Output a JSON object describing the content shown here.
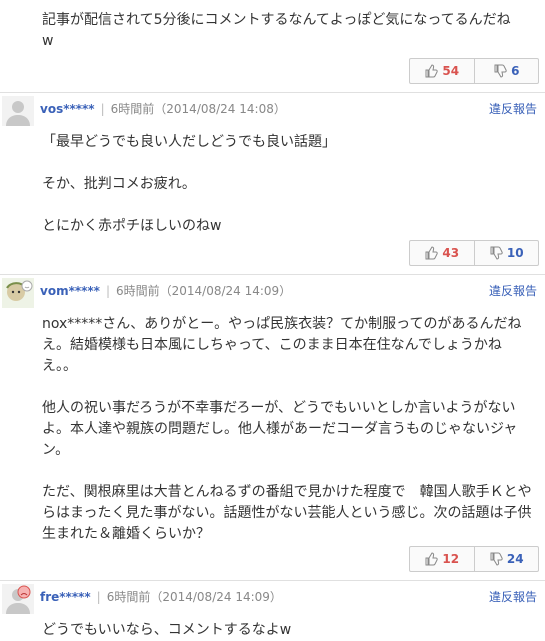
{
  "comments": [
    {
      "body": "記事が配信されて5分後にコメントするなんてよっぽど気になってるんだね\nw",
      "likes": "54",
      "dislikes": "6"
    },
    {
      "user": "vos*****",
      "time": "6時間前（2014/08/24 14:08）",
      "report": "違反報告",
      "body": "「最早どうでも良い人だしどうでも良い話題」\n\nそか、批判コメお疲れ。\n\nとにかく赤ポチほしいのねw",
      "likes": "43",
      "dislikes": "10"
    },
    {
      "user": "vom*****",
      "time": "6時間前（2014/08/24 14:09）",
      "report": "違反報告",
      "body": "nox*****さん、ありがとー。やっぱ民族衣装？てか制服ってのがあるんだねえ。結婚模様も日本風にしちゃって、このまま日本在住なんでしょうかねえ。。\n\n他人の祝い事だろうが不幸事だろーが、どうでもいいとしか言いようがないよ。本人達や親族の問題だし。他人様があーだコーダ言うものじゃないジャン。\n\nただ、関根麻里は大昔とんねるずの番組で見かけた程度で　韓国人歌手Ｋとやらはまったく見た事がない。話題性がない芸能人という感じ。次の話題は子供生まれた＆離婚くらいか？",
      "likes": "12",
      "dislikes": "24"
    },
    {
      "user": "fre*****",
      "time": "6時間前（2014/08/24 14:09）",
      "report": "違反報告",
      "body": "どうでもいいなら、コメントするなよw"
    }
  ],
  "colors": {
    "link": "#3a61b8",
    "like": "#d9534f",
    "dislike": "#3a61b8"
  },
  "icons": {
    "like": "thumbs-up-icon",
    "dislike": "thumbs-down-icon",
    "avatar": "user-avatar-icon"
  }
}
